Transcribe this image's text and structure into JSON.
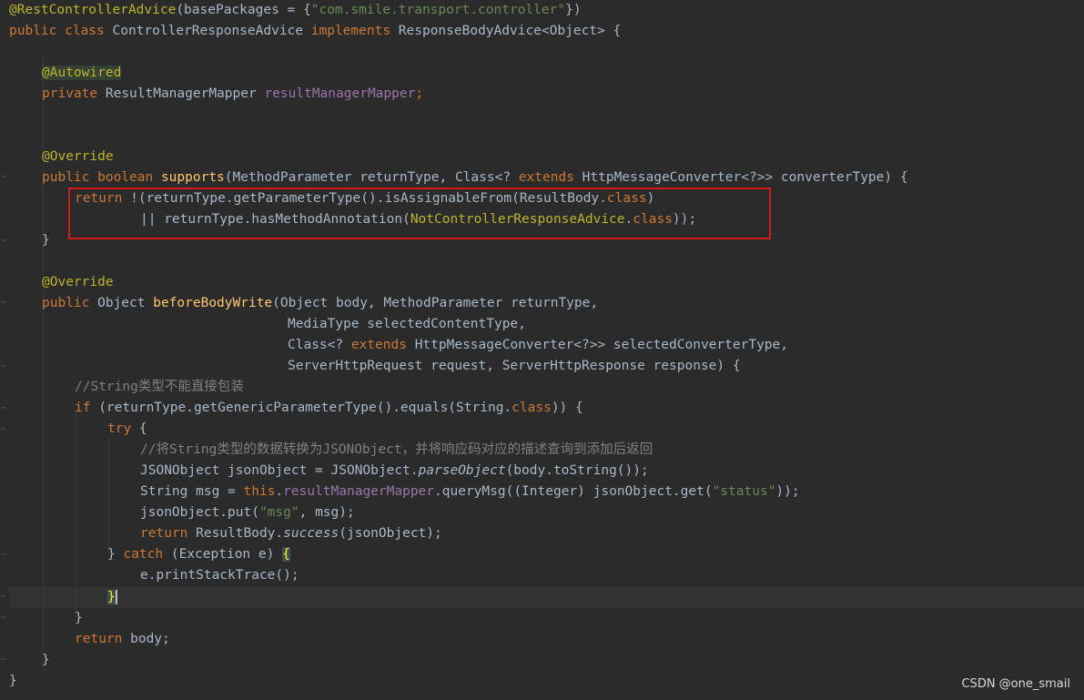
{
  "editor": {
    "background": "#2b2b2b",
    "theme_colors": {
      "keyword": "#cc7832",
      "annotation": "#bbb529",
      "string": "#6a8759",
      "method_decl": "#ffc66d",
      "field": "#9876aa",
      "comment": "#808080",
      "default": "#a9b7c6",
      "highlight_box": "#d41a1a"
    }
  },
  "code": {
    "l1": {
      "ann": "@RestControllerAdvice",
      "p1": "(basePackages = {",
      "str": "\"com.smile.transport.controller\"",
      "p2": "})"
    },
    "l2": {
      "kw1": "public class ",
      "name": "ControllerResponseAdvice ",
      "kw2": "implements ",
      "rest": "ResponseBodyAdvice<Object> {"
    },
    "l3": {
      "ann": "@Autowired"
    },
    "l4": {
      "kw": "private ",
      "type": "ResultManagerMapper ",
      "field": "resultManagerMapper",
      "semi": ";"
    },
    "l5": {
      "ann": "@Override"
    },
    "l6": {
      "kw1": "public boolean ",
      "fn": "supports",
      "p1": "(MethodParameter returnType, Class<? ",
      "kw2": "extends ",
      "p2": "HttpMessageConverter<?>> converterType) {"
    },
    "l7": {
      "kw": "return ",
      "p1": "!(returnType.getParameterType().isAssignableFrom(ResultBody.",
      "kw2": "class",
      "p2": ")"
    },
    "l8": {
      "p1": "|| returnType.hasMethodAnnotation(",
      "ann": "NotControllerResponseAdvice",
      "p2": ".",
      "kw": "class",
      "p3": "));"
    },
    "l9": {
      "brace": "}"
    },
    "l10": {
      "ann": "@Override"
    },
    "l11": {
      "kw": "public ",
      "type": "Object ",
      "fn": "beforeBodyWrite",
      "p1": "(Object body, MethodParameter returnType,"
    },
    "l12": {
      "text": "MediaType selectedContentType,"
    },
    "l13": {
      "p1": "Class<? ",
      "kw": "extends ",
      "p2": "HttpMessageConverter<?>> selectedConverterType,"
    },
    "l14": {
      "text": "ServerHttpRequest request, ServerHttpResponse response) {"
    },
    "l15": {
      "cmt": "//String类型不能直接包装"
    },
    "l16": {
      "kw": "if ",
      "p1": "(returnType.getGenericParameterType().equals(String.",
      "kw2": "class",
      "p2": ")) {"
    },
    "l17": {
      "kw": "try ",
      "p1": "{"
    },
    "l18": {
      "cmt": "//将String类型的数据转换为JSONObject，并将响应码对应的描述查询到添加后返回"
    },
    "l19": {
      "p1": "JSONObject jsonObject = JSONObject.",
      "itl": "parseObject",
      "p2": "(body.toString());"
    },
    "l20": {
      "p1": "String msg = ",
      "kw": "this",
      "p2": ".",
      "fld": "resultManagerMapper",
      "p3": ".queryMsg((Integer) jsonObject.get(",
      "str": "\"status\"",
      "p4": "));"
    },
    "l21": {
      "p1": "jsonObject.put(",
      "str": "\"msg\"",
      "p2": ", msg);"
    },
    "l22": {
      "kw": "return ",
      "p1": "ResultBody.",
      "itl": "success",
      "p2": "(jsonObject);"
    },
    "l23": {
      "p1": "} ",
      "kw": "catch ",
      "p2": "(Exception e) ",
      "brace": "{"
    },
    "l24": {
      "text": "e.printStackTrace();"
    },
    "l25": {
      "brace": "}"
    },
    "l26": {
      "brace": "}"
    },
    "l27": {
      "kw": "return ",
      "p1": "body;"
    },
    "l28": {
      "brace": "}"
    },
    "l29": {
      "brace": "}"
    }
  },
  "watermark": "CSDN @one_smail"
}
